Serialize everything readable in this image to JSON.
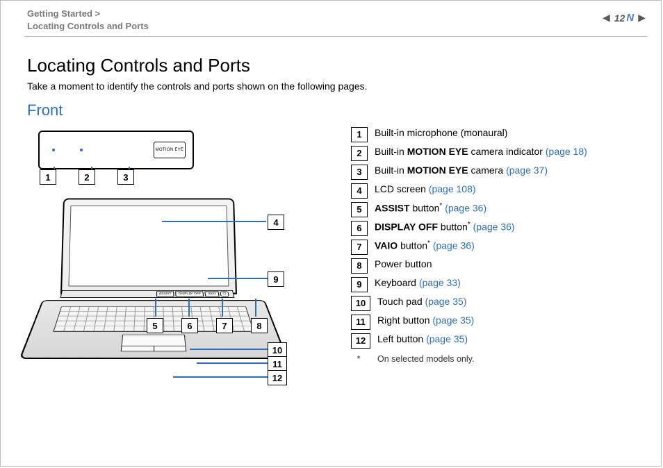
{
  "breadcrumb": {
    "line1": "Getting Started >",
    "line2": "Locating Controls and Ports"
  },
  "page_number": "12",
  "nav_n": "N",
  "title": "Locating Controls and Ports",
  "intro": "Take a moment to identify the controls and ports shown on the following pages.",
  "section_title": "Front",
  "inset_cam_label": "MOTION EYE",
  "hinge_buttons": {
    "assist": "ASSIST",
    "display_off": "DISPLAY OFF",
    "vaio": "VAIO",
    "power": "⏻"
  },
  "legend": {
    "1": {
      "bold": "",
      "text": "Built-in microphone (monaural)",
      "page": ""
    },
    "2": {
      "bold": "MOTION EYE",
      "pre": "Built-in ",
      "post": " camera indicator ",
      "page": "(page 18)"
    },
    "3": {
      "bold": "MOTION EYE",
      "pre": "Built-in ",
      "post": " camera ",
      "page": "(page 37)"
    },
    "4": {
      "bold": "",
      "text": "LCD screen ",
      "page": "(page 108)"
    },
    "5": {
      "bold": "ASSIST",
      "post": " button",
      "star": "*",
      "page": " (page 36)"
    },
    "6": {
      "bold": "DISPLAY OFF",
      "post": " button",
      "star": "*",
      "page": " (page 36)"
    },
    "7": {
      "bold": "VAIO",
      "post": " button",
      "star": "*",
      "page": " (page 36)"
    },
    "8": {
      "bold": "",
      "text": "Power button",
      "page": ""
    },
    "9": {
      "bold": "",
      "text": "Keyboard ",
      "page": "(page 33)"
    },
    "10": {
      "bold": "",
      "text": "Touch pad ",
      "page": "(page 35)"
    },
    "11": {
      "bold": "",
      "text": "Right button ",
      "page": "(page 35)"
    },
    "12": {
      "bold": "",
      "text": "Left button ",
      "page": "(page 35)"
    }
  },
  "footnote": {
    "star": "*",
    "text": "On selected models only."
  }
}
